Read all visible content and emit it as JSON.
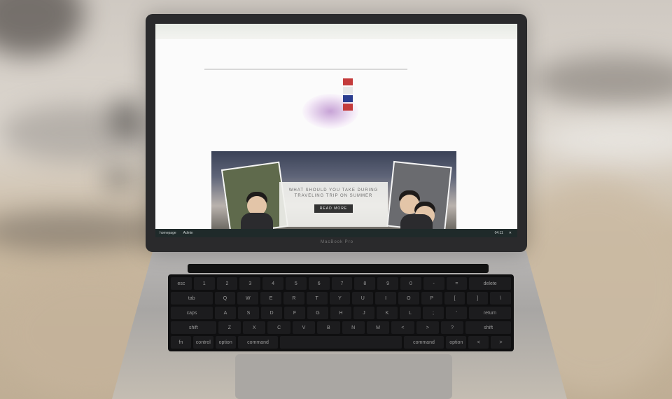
{
  "hero": {
    "title": "WHAT SHOULD YOU TAKE DURING TRAVELING TRIP ON SUMMER",
    "button": "READ MORE"
  },
  "taskbar": {
    "home": "homepage",
    "admin": "Admin",
    "clock": "04:11"
  },
  "brand": "MacBook Pro",
  "keyboard": {
    "rows": [
      [
        "esc",
        "1",
        "2",
        "3",
        "4",
        "5",
        "6",
        "7",
        "8",
        "9",
        "0",
        "-",
        "=",
        "delete"
      ],
      [
        "tab",
        "Q",
        "W",
        "E",
        "R",
        "T",
        "Y",
        "U",
        "I",
        "O",
        "P",
        "[",
        "]",
        "\\"
      ],
      [
        "caps",
        "A",
        "S",
        "D",
        "F",
        "G",
        "H",
        "J",
        "K",
        "L",
        ";",
        "'",
        "return"
      ],
      [
        "shift",
        "Z",
        "X",
        "C",
        "V",
        "B",
        "N",
        "M",
        "<",
        ">",
        "?",
        "shift"
      ],
      [
        "fn",
        "control",
        "option",
        "command",
        "",
        "command",
        "option",
        "<",
        ">"
      ]
    ]
  },
  "colors": {
    "screen_bg": "#fbfbfb",
    "laptop_body": "#2a2a2c",
    "taskbar": "#1f2a2a"
  }
}
